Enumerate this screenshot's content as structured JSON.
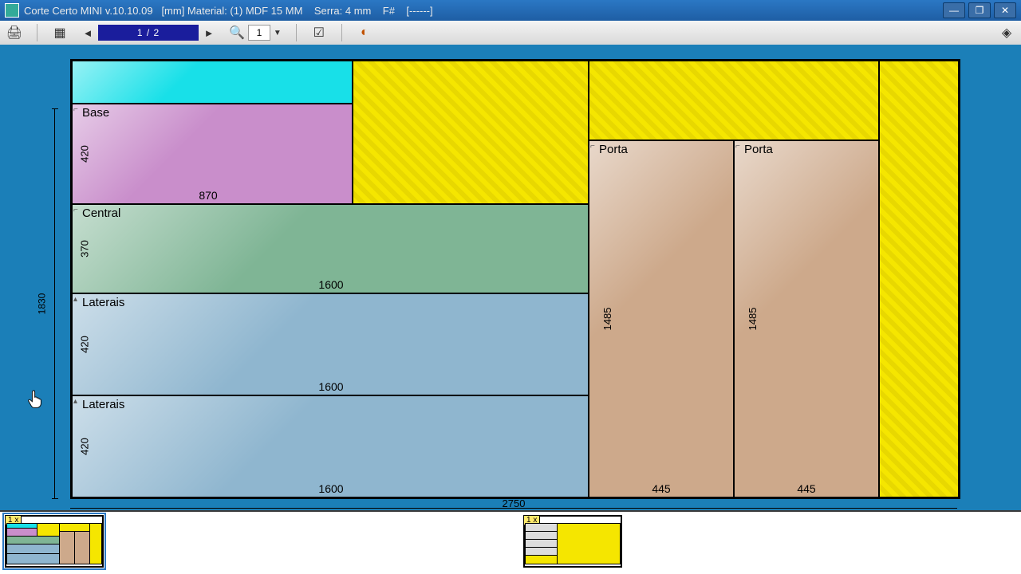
{
  "window": {
    "title": "Corte Certo MINI v.10.10.09   [mm] Material: (1) MDF 15 MM    Serra: 4 mm    F#    [------]"
  },
  "toolbar": {
    "page_display": "1 / 2",
    "zoom_value": "1"
  },
  "sheet": {
    "width_label": "2750",
    "height_label": "1830"
  },
  "pieces": {
    "topCyan": {
      "name": "",
      "w": "",
      "h": ""
    },
    "base": {
      "name": "Base",
      "w": "870",
      "h": "420"
    },
    "central": {
      "name": "Central",
      "w": "1600",
      "h": "370"
    },
    "lat1": {
      "name": "Laterais",
      "w": "1600",
      "h": "420"
    },
    "lat2": {
      "name": "Laterais",
      "w": "1600",
      "h": "420"
    },
    "porta1": {
      "name": "Porta",
      "w": "445",
      "h": "1485"
    },
    "porta2": {
      "name": "Porta",
      "w": "445",
      "h": "1485"
    }
  },
  "thumbs": {
    "badge1": "1 x",
    "badge2": "1 x"
  }
}
